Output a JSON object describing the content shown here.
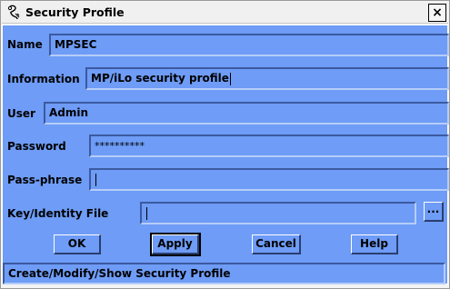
{
  "window": {
    "title": "Security Profile",
    "close_label": "×",
    "icon": "security-profile-icon"
  },
  "form": {
    "name_label": "Name",
    "name_value": "MPSEC",
    "information_label": "Information",
    "information_value": "MP/iLo security profile",
    "user_label": "User",
    "user_value": "Admin",
    "password_label": "Password",
    "password_value": "**********",
    "passphrase_label": "Pass-phrase",
    "passphrase_value": "",
    "keyfile_label": "Key/Identity File",
    "keyfile_value": "",
    "browse_label": "..."
  },
  "buttons": {
    "ok": "OK",
    "apply": "Apply",
    "cancel": "Cancel",
    "help": "Help"
  },
  "status": {
    "text": "Create/Modify/Show Security Profile"
  },
  "colors": {
    "panel": "#6e9cf6",
    "titlebar": "#f0f0f0"
  }
}
